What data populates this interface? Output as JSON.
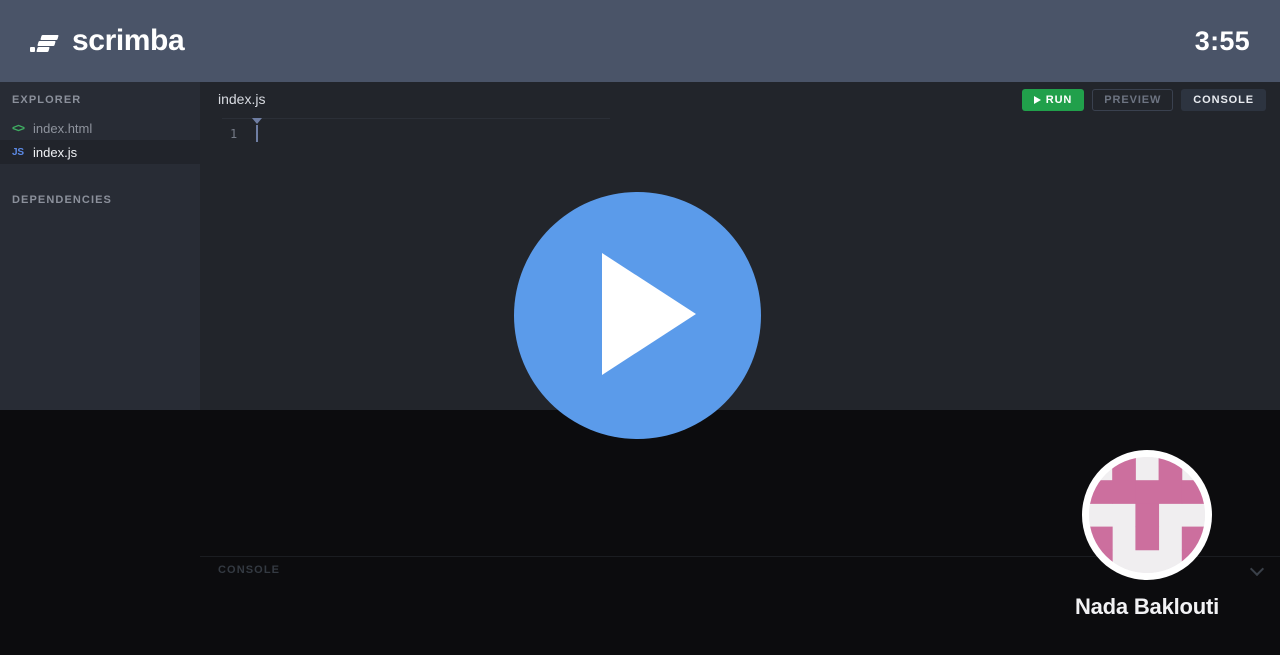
{
  "header": {
    "brand_name": "scrimba",
    "logo_icon": "scrimba-logo-icon",
    "timer": "3:55"
  },
  "sidebar": {
    "explorer_title": "EXPLORER",
    "dependencies_title": "DEPENDENCIES",
    "files": [
      {
        "name": "index.html",
        "icon": "html-file-icon",
        "icon_label": "<>",
        "active": false
      },
      {
        "name": "index.js",
        "icon": "js-file-icon",
        "icon_label": "JS",
        "active": true
      }
    ]
  },
  "editor": {
    "tab_name": "index.js",
    "line_number": "1",
    "code": "",
    "actions": {
      "run_label": "RUN",
      "run_icon": "play-icon",
      "preview_label": "PREVIEW",
      "console_label": "CONSOLE"
    }
  },
  "console": {
    "label": "CONSOLE",
    "collapse_icon": "chevron-down-icon"
  },
  "overlay": {
    "play_icon": "play-icon",
    "play_color": "#5b9bea"
  },
  "author": {
    "name": "Nada Baklouti",
    "avatar_icon": "identicon-avatar",
    "avatar_fg": "#cc6f9e",
    "avatar_bg": "#f0eef0",
    "avatar_grid": [
      [
        0,
        1,
        0,
        1,
        0
      ],
      [
        1,
        1,
        1,
        1,
        1
      ],
      [
        0,
        0,
        1,
        0,
        0
      ],
      [
        1,
        0,
        1,
        0,
        1
      ],
      [
        1,
        0,
        0,
        0,
        1
      ]
    ]
  },
  "colors": {
    "header_bg": "#4a5468",
    "sidebar_bg": "#282c35",
    "editor_bg": "#22252b",
    "stage_bg": "#0c0c0e",
    "run_green": "#21a04b",
    "console_btn": "#2d3440"
  }
}
